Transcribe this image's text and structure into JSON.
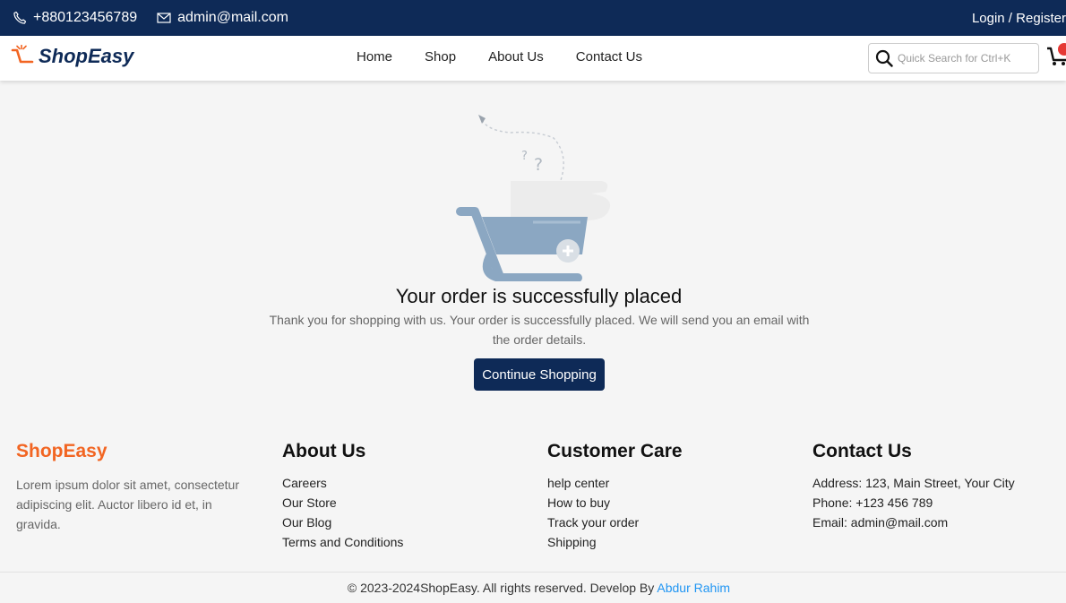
{
  "topbar": {
    "phone": "+880123456789",
    "email": "admin@mail.com",
    "login": "Login / Register"
  },
  "header": {
    "brand": "ShopEasy",
    "nav": [
      "Home",
      "Shop",
      "About Us",
      "Contact Us"
    ],
    "search_placeholder": "Quick Search for Ctrl+K",
    "icons": [
      "phone-icon",
      "mail-icon",
      "search-icon",
      "cart-icon"
    ]
  },
  "main": {
    "title": "Your order is successfully placed",
    "message": "Thank you for shopping with us. Your order is successfully placed. We will send you an email with the order details.",
    "cta": "Continue Shopping"
  },
  "footer": {
    "brand": "ShopEasy",
    "about_text": "Lorem ipsum dolor sit amet, consectetur adipiscing elit. Auctor libero id et, in gravida.",
    "columns": [
      {
        "title": "About Us",
        "links": [
          "Careers",
          "Our Store",
          "Our Blog",
          "Terms and Conditions"
        ]
      },
      {
        "title": "Customer Care",
        "links": [
          "help center",
          "How to buy",
          "Track your order",
          "Shipping"
        ]
      },
      {
        "title": "Contact Us",
        "links": [
          "Address: 123, Main Street, Your City",
          "Phone: +123 456 789",
          "Email: admin@mail.com"
        ]
      }
    ],
    "copyright_prefix": "© 2023-2024ShopEasy. All rights reserved. Develop By",
    "author": "Abdur Rahim"
  },
  "colors": {
    "primary": "#0e2a57",
    "brand_orange": "#f26522",
    "link_blue": "#2196f3",
    "cart_illustration": "#8ba7c2"
  }
}
